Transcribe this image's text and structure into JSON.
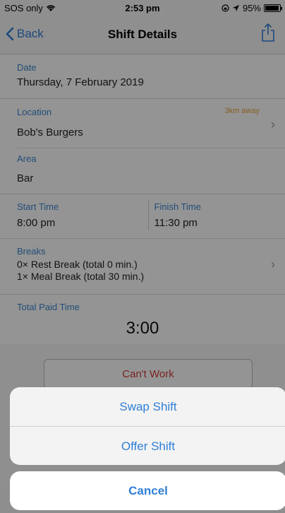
{
  "status": {
    "carrier": "SOS only",
    "time": "2:53 pm",
    "battery": "95%",
    "battery_level": 0.95
  },
  "nav": {
    "back_label": "Back",
    "title": "Shift Details"
  },
  "date": {
    "label": "Date",
    "value": "Thursday, 7 February 2019"
  },
  "location": {
    "label": "Location",
    "distance": "3km away",
    "value": "Bob's Burgers"
  },
  "area": {
    "label": "Area",
    "value": "Bar"
  },
  "times": {
    "start_label": "Start Time",
    "start_value": "8:00 pm",
    "finish_label": "Finish Time",
    "finish_value": "11:30 pm"
  },
  "breaks": {
    "label": "Breaks",
    "line1": "0× Rest Break (total 0 min.)",
    "line2": "1× Meal Break (total 30 min.)"
  },
  "paid": {
    "label": "Total Paid Time",
    "value": "3:00"
  },
  "cant_work_label": "Can't Work",
  "action_sheet": {
    "swap_label": "Swap Shift",
    "offer_label": "Offer Shift",
    "cancel_label": "Cancel"
  },
  "colors": {
    "accent": "#2f7fd6",
    "label_blue": "#3a86cf",
    "distance_orange": "#e8a23a",
    "danger_red": "#d23b3b"
  },
  "icons": {
    "back": "chevron-left-icon",
    "share": "share-icon",
    "wifi": "wifi-icon",
    "location": "location-arrow-icon",
    "battery": "battery-icon",
    "disclosure": "chevron-right-icon"
  }
}
